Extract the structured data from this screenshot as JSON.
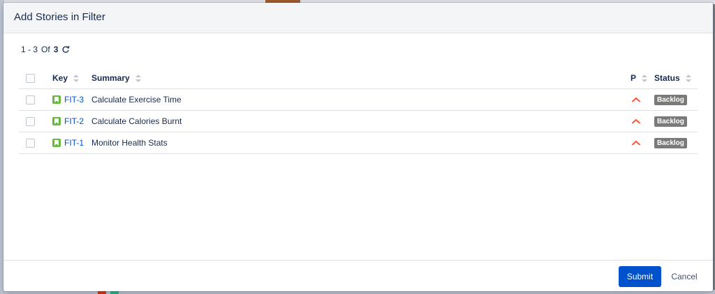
{
  "modal": {
    "title": "Add Stories in Filter"
  },
  "pager": {
    "range": "1 - 3",
    "of_label": "Of",
    "total": "3",
    "refresh_icon": "refresh-icon"
  },
  "table": {
    "columns": {
      "key": "Key",
      "summary": "Summary",
      "priority": "P",
      "status": "Status"
    },
    "rows": [
      {
        "key": "FIT-3",
        "summary": "Calculate Exercise Time",
        "priority_icon": "priority-high-icon",
        "status": "Backlog"
      },
      {
        "key": "FIT-2",
        "summary": "Calculate Calories Burnt",
        "priority_icon": "priority-high-icon",
        "status": "Backlog"
      },
      {
        "key": "FIT-1",
        "summary": "Monitor Health Stats",
        "priority_icon": "priority-high-icon",
        "status": "Backlog"
      }
    ]
  },
  "footer": {
    "submit_label": "Submit",
    "cancel_label": "Cancel"
  },
  "colors": {
    "accent": "#0052cc",
    "story": "#63ba3c",
    "priority": "#ff5630",
    "badge": "#7a7a7a"
  }
}
